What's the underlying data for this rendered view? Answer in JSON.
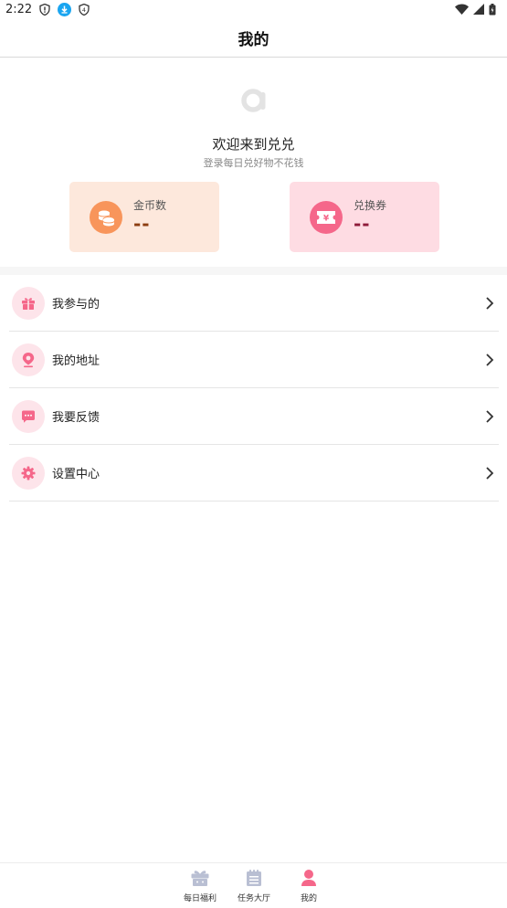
{
  "status_bar": {
    "time": "2:22",
    "icons": [
      "shield-alert-icon",
      "download-icon",
      "vpn-key-icon",
      "wifi-icon",
      "signal-icon",
      "battery-icon"
    ]
  },
  "header": {
    "title": "我的"
  },
  "profile": {
    "avatar_icon": "logo-a-icon",
    "welcome": "欢迎来到兑兑",
    "subtitle": "登录每日兑好物不花钱"
  },
  "cards": {
    "coins": {
      "label": "金币数",
      "value": "--",
      "icon": "coins-icon",
      "color": "#f8955b"
    },
    "vouchers": {
      "label": "兑换券",
      "value": "--",
      "icon": "ticket-icon",
      "color": "#f5678a"
    }
  },
  "menu": {
    "items": [
      {
        "label": "我参与的",
        "icon": "gift-icon"
      },
      {
        "label": "我的地址",
        "icon": "location-pin-icon"
      },
      {
        "label": "我要反馈",
        "icon": "chat-bubble-icon"
      },
      {
        "label": "设置中心",
        "icon": "gear-icon"
      }
    ]
  },
  "bottom_nav": {
    "items": [
      {
        "label": "每日福利",
        "icon": "gift-box-icon",
        "active": false
      },
      {
        "label": "任务大厅",
        "icon": "calendar-icon",
        "active": false
      },
      {
        "label": "我的",
        "icon": "user-icon",
        "active": true
      }
    ],
    "accent_color": "#f5678a",
    "inactive_color": "#b9bfd3"
  }
}
